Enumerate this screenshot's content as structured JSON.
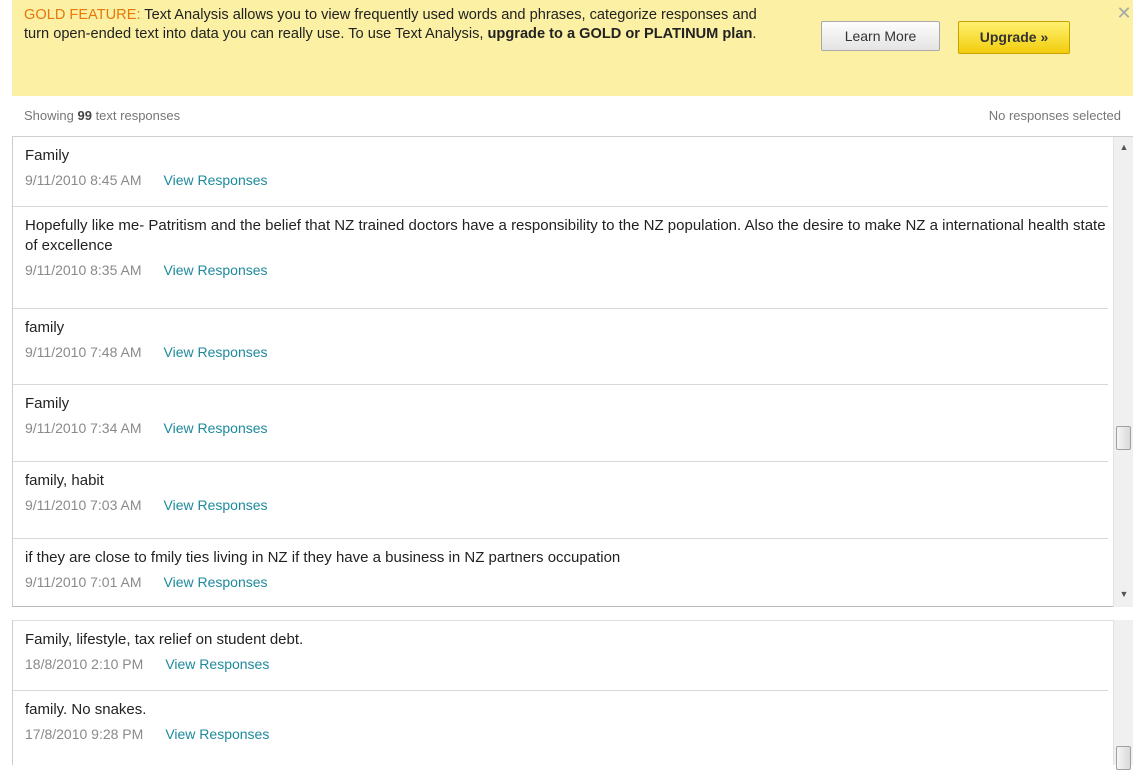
{
  "banner": {
    "lead": "GOLD FEATURE:",
    "text": " Text Analysis allows you to view frequently used words and phrases, categorize responses and turn open-ended text into data you can really use. To use Text Analysis, ",
    "emphasis": "upgrade to a GOLD or PLATINUM plan",
    "tail": ".",
    "learn_more_label": "Learn More",
    "upgrade_label": "Upgrade »",
    "close_label": "✕"
  },
  "summary": {
    "showing_prefix": "Showing ",
    "count": "99",
    "showing_suffix": " text responses",
    "selection_status": "No responses selected"
  },
  "responses": [
    {
      "text": "Family",
      "date": "9/11/2010 8:45 AM",
      "link": "View Responses"
    },
    {
      "text": "Hopefully like me- Patritism and the belief that NZ trained doctors have a responsibility to the NZ population. Also the desire to make NZ a international health state of excellence",
      "date": "9/11/2010 8:35 AM",
      "link": "View Responses"
    },
    {
      "text": "family",
      "date": "9/11/2010 7:48 AM",
      "link": "View Responses"
    },
    {
      "text": "Family",
      "date": "9/11/2010 7:34 AM",
      "link": "View Responses"
    },
    {
      "text": "family, habit",
      "date": "9/11/2010 7:03 AM",
      "link": "View Responses"
    },
    {
      "text": "if they are close to fmily ties living in NZ if they have a business in NZ partners occupation",
      "date": "9/11/2010 7:01 AM",
      "link": "View Responses"
    }
  ],
  "responses_lower": [
    {
      "text": "Family, lifestyle, tax relief on student debt.",
      "date": "18/8/2010 2:10 PM",
      "link": "View Responses"
    },
    {
      "text": "family. No snakes.",
      "date": "17/8/2010 9:28 PM",
      "link": "View Responses"
    }
  ],
  "colors": {
    "banner_bg": "#fbf0a3",
    "lead": "#e8780a",
    "link": "#1d8a9c",
    "upgrade_button": "#f2cd0c"
  },
  "icons": {
    "close": "close-icon",
    "scroll_up": "scroll-up-arrow-icon",
    "scroll_down": "scroll-down-arrow-icon"
  }
}
